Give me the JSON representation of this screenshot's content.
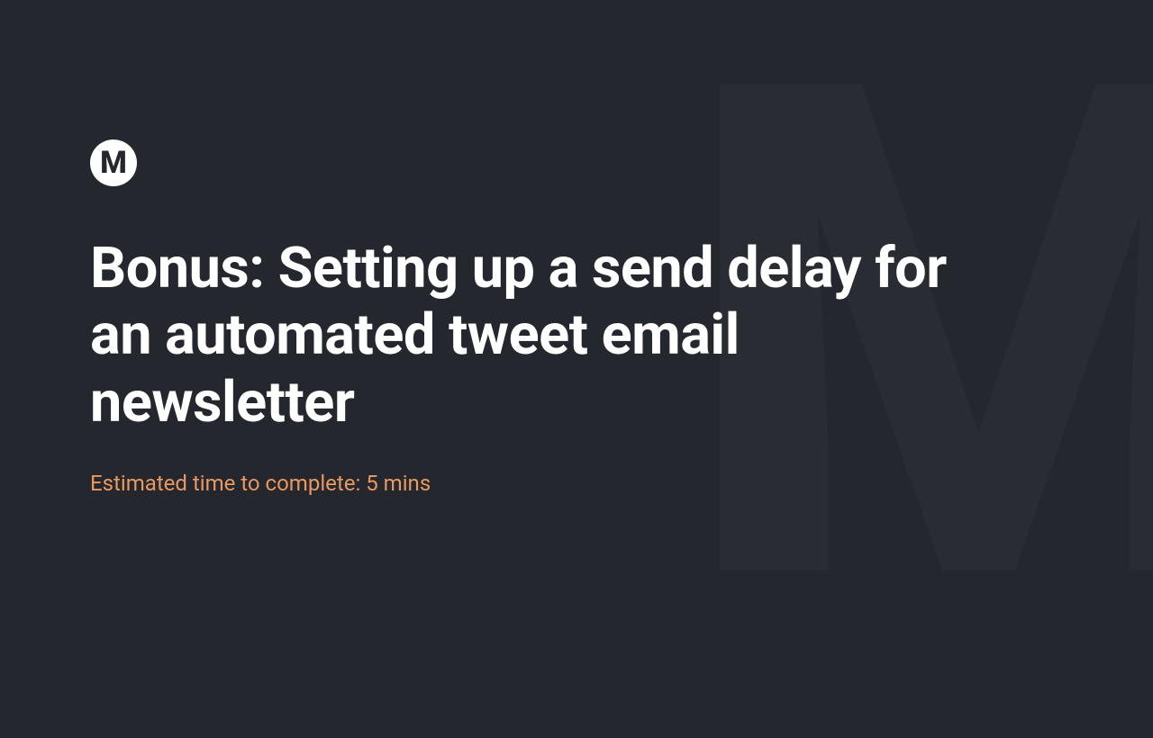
{
  "logo": {
    "letter": "M"
  },
  "watermark": {
    "letter": "M"
  },
  "title": "Bonus: Setting up a send delay for an automated tweet email newsletter",
  "subtitle": "Estimated time to complete: 5 mins"
}
